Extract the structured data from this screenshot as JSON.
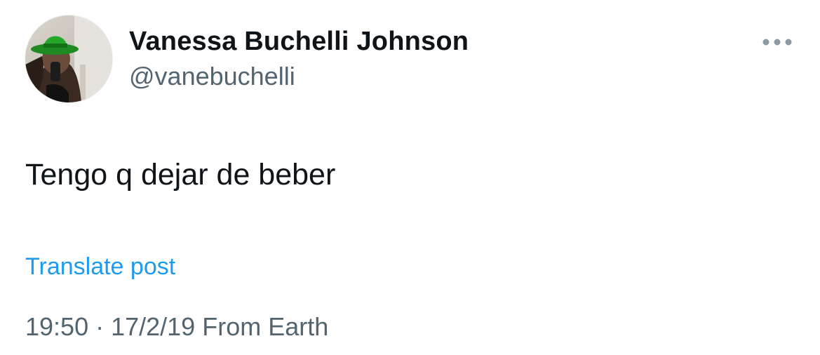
{
  "post": {
    "author": {
      "display_name": "Vanessa Buchelli Johnson",
      "handle": "@vanebuchelli"
    },
    "text": "Tengo q dejar de beber",
    "translate_label": "Translate post",
    "timestamp": {
      "time": "19:50",
      "separator": " · ",
      "date": "17/2/19",
      "source": " From Earth"
    },
    "more_icon": "more-horizontal-icon"
  },
  "colors": {
    "text_primary": "#0f1419",
    "text_secondary": "#536471",
    "link": "#1d9bf0",
    "background": "#ffffff"
  }
}
